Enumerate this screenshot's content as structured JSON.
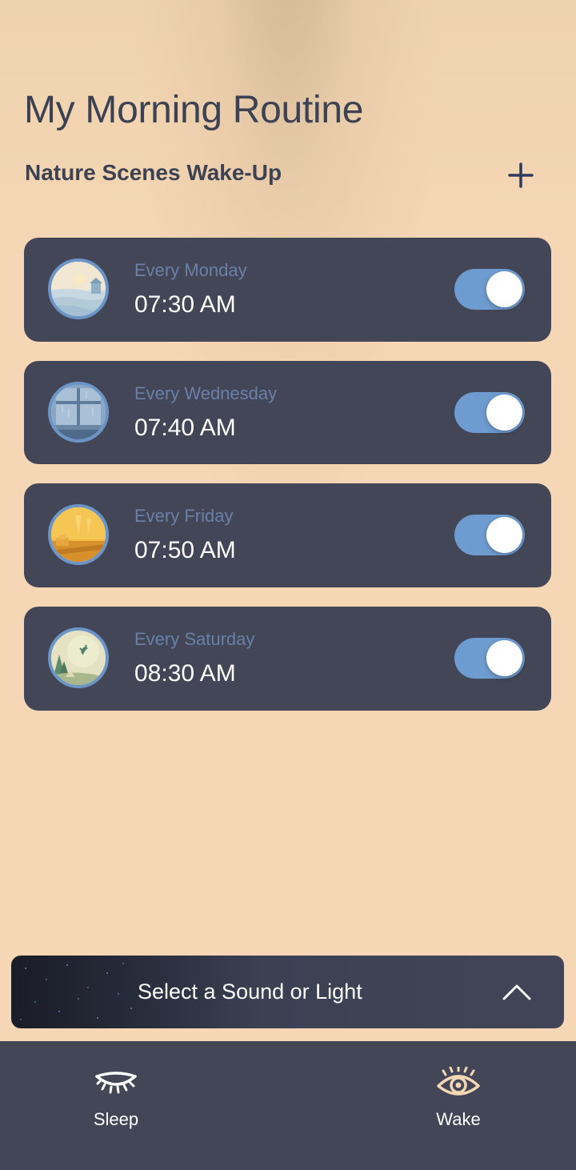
{
  "header": {
    "title": "My Morning Routine",
    "subtitle": "Nature Scenes Wake-Up",
    "add_icon": "plus-icon"
  },
  "alarms": [
    {
      "repeat": "Every Monday",
      "time": "07:30 AM",
      "enabled": true,
      "scene": "lake-sunrise"
    },
    {
      "repeat": "Every Wednesday",
      "time": "07:40 AM",
      "enabled": true,
      "scene": "rainy-window"
    },
    {
      "repeat": "Every Friday",
      "time": "07:50 AM",
      "enabled": true,
      "scene": "sunny-kitchen"
    },
    {
      "repeat": "Every Saturday",
      "time": "08:30 AM",
      "enabled": true,
      "scene": "forest-bird"
    }
  ],
  "sound_selector": {
    "label": "Select a Sound or Light",
    "icon": "chevron-up-icon"
  },
  "tabs": [
    {
      "label": "Sleep",
      "icon": "closed-eye-icon",
      "active": false
    },
    {
      "label": "Wake",
      "icon": "open-eye-icon",
      "active": true
    }
  ],
  "colors": {
    "background": "#f5d7b5",
    "card": "#424656",
    "toggle_on": "#6e9bd0",
    "text_dark": "#3c4154",
    "repeat_text": "#6a80a8",
    "wake_accent": "#f5d7b5"
  }
}
